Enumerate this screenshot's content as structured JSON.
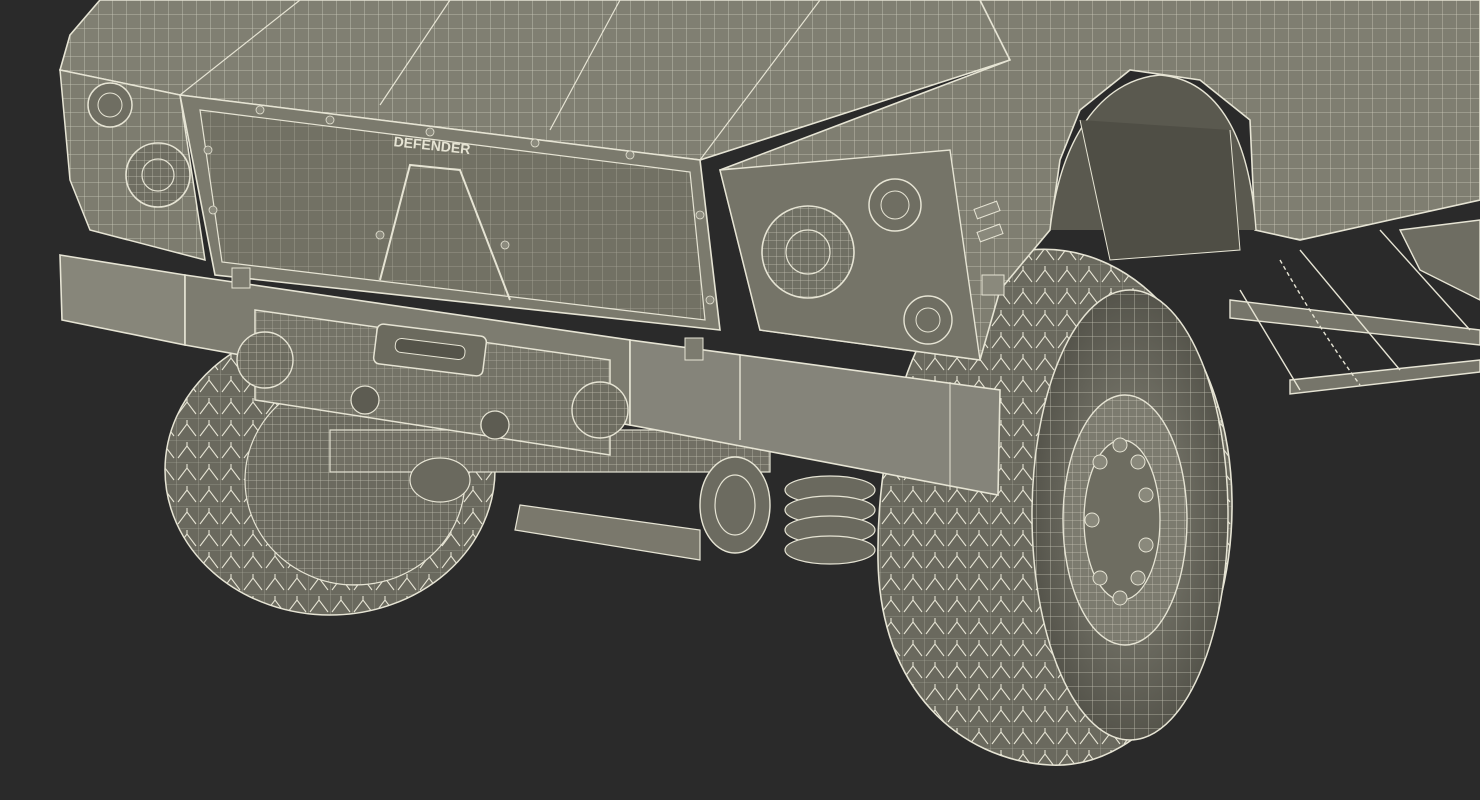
{
  "scene": {
    "subject": "vehicle-front-wireframe",
    "background_color": "#2a2a2a",
    "surface_color": "#7e7d70",
    "surface_dark_color": "#5e5d53",
    "wire_color": "#e6e4d4",
    "grille_badge_text": "DEFENDER"
  }
}
